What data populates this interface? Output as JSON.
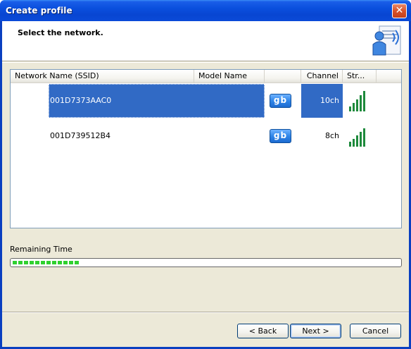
{
  "window": {
    "title": "Create profile",
    "close_glyph": "✕"
  },
  "header": {
    "title": "Select the network.",
    "icon": "wireless-profile-icon"
  },
  "network_list": {
    "columns": [
      {
        "label": "Network Name (SSID)"
      },
      {
        "label": "Model Name"
      },
      {
        "label": ""
      },
      {
        "label": "Channel"
      },
      {
        "label": "Str..."
      }
    ],
    "rows": [
      {
        "ssid": "001D7373AAC0",
        "model": "",
        "band": "gb",
        "channel": "10ch",
        "signal_bars": 5,
        "selected": true
      },
      {
        "ssid": "001D739512B4",
        "model": "",
        "band": "gb",
        "channel": "8ch",
        "signal_bars": 5,
        "selected": false
      }
    ]
  },
  "remaining_time": {
    "label": "Remaining Time",
    "progress_fraction": 0.18
  },
  "buttons": {
    "back": "< Back",
    "next": "Next >",
    "cancel": "Cancel"
  },
  "colors": {
    "selection": "#316ac5",
    "progress": "#2fd02f",
    "signal": "#1e8a3c"
  }
}
